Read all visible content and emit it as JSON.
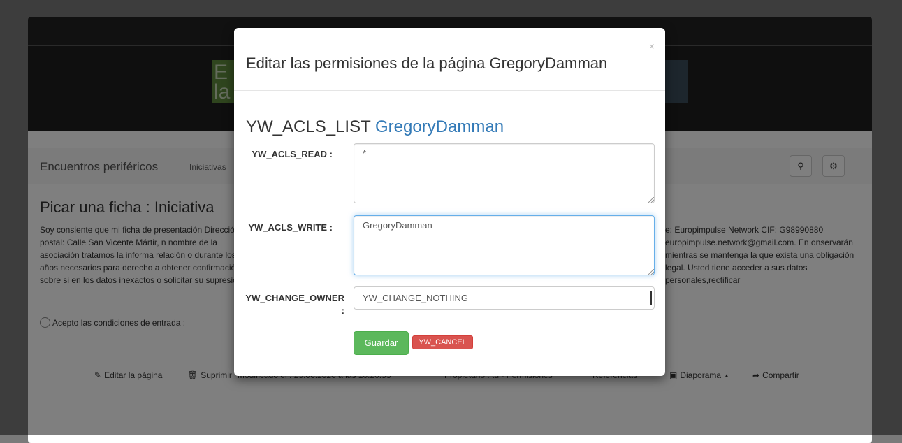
{
  "navbar": {
    "brand": "Encuentros periféricos",
    "link": "Iniciativas",
    "search_icon": "search-icon",
    "settings_icon": "gear-icon"
  },
  "page": {
    "title": "Picar una ficha :  Iniciativa",
    "banner_letters": "E\nla",
    "consent_left": "Soy consiente que mi ficha de presentación Dirección postal: Calle San Vicente Mártir, n nombre de la asociación tratamos la informa relación o durante los años necesarios para derecho a obtener confirmación sobre si en los datos inexactos o solicitar su supresión c",
    "consent_right": "e: Europimpulse Network CIF: G98990880 europimpulse.network@gmail.com. En onservarán mientras se mantenga la que exista una obligación legal. Usted tiene acceder a sus datos personales,rectificar",
    "checkbox_label": "Acepto las condiciones de entrada :"
  },
  "footer": {
    "edit": "Editar la página",
    "delete": "Suprimir",
    "modified": "Modificado el : 25.06.2020 a las 10:20:53",
    "owner": "Propietario : tú - Permisiones",
    "references": "Referencias",
    "slideshow": "Diaporama",
    "share": "Compartir"
  },
  "modal": {
    "title": "Editar las permisiones de la página GregoryDamman",
    "close": "×",
    "acl_heading": "YW_ACLS_LIST",
    "acl_page": "GregoryDamman",
    "read_label": "YW_ACLS_READ :",
    "read_value": "*",
    "write_label": "YW_ACLS_WRITE :",
    "write_value": "GregoryDamman",
    "owner_label": "YW_CHANGE_OWNER :",
    "owner_value": "YW_CHANGE_NOTHING",
    "save_label": "Guardar",
    "cancel_label": "YW_CANCEL"
  },
  "colors": {
    "save": "#5cb85c",
    "cancel": "#d9534f",
    "link": "#337ab7",
    "focus": "#66afe9"
  }
}
